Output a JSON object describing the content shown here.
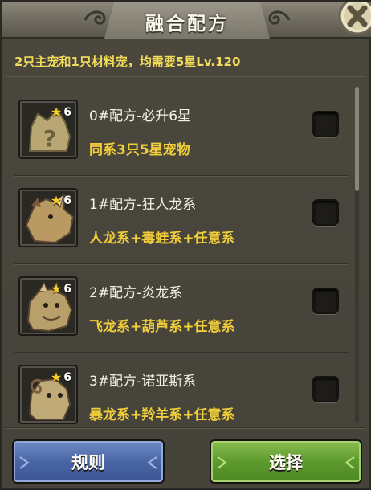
{
  "dialog": {
    "title": "融合配方",
    "subtitle": "2只主宠和1只材料宠，均需要5星Lv.120"
  },
  "recipes": [
    {
      "name": "0#配方-必升6星",
      "requirement": "同系3只5星宠物",
      "star_level": "6",
      "icon": "mystery-pet-icon"
    },
    {
      "name": "1#配方-狂人龙系",
      "requirement": "人龙系+毒蛙系+任意系",
      "star_level": "6",
      "icon": "rhino-dragon-pet-icon"
    },
    {
      "name": "2#配方-炎龙系",
      "requirement": "飞龙系+葫芦系+任意系",
      "star_level": "6",
      "icon": "fire-dragon-pet-icon"
    },
    {
      "name": "3#配方-诺亚斯系",
      "requirement": "暴龙系+羚羊系+任意系",
      "star_level": "6",
      "icon": "ram-dragon-pet-icon"
    }
  ],
  "buttons": {
    "rules_label": "规则",
    "select_label": "选择"
  },
  "colors": {
    "accent_yellow": "#f0cd3a",
    "rules_button": "#4a66a5",
    "select_button": "#5d9a2d"
  }
}
